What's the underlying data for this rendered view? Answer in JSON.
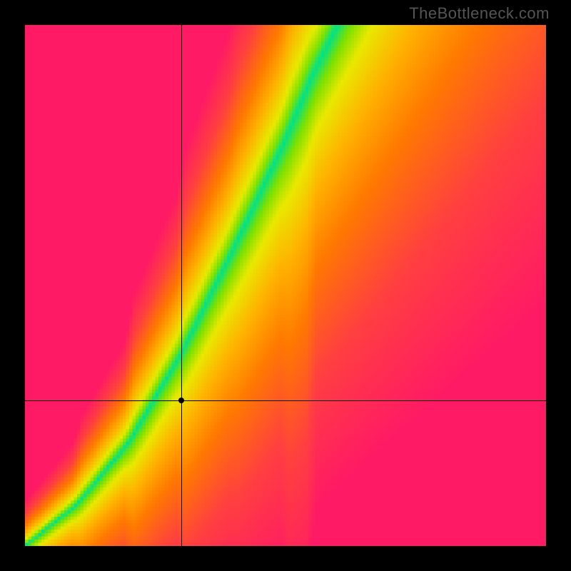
{
  "watermark": "TheBottleneck.com",
  "chart_data": {
    "type": "heatmap",
    "title": "",
    "xlabel": "",
    "ylabel": "",
    "xlim": [
      0,
      1
    ],
    "ylim": [
      0,
      1
    ],
    "grid_resolution": 160,
    "marker": {
      "x": 0.3,
      "y": 0.28
    },
    "crosshair": {
      "x": 0.3,
      "y": 0.28
    },
    "optimal_curve": {
      "description": "green ridge: ideal GPU/CPU pairing",
      "points": [
        [
          0.0,
          0.0
        ],
        [
          0.1,
          0.08
        ],
        [
          0.2,
          0.2
        ],
        [
          0.3,
          0.37
        ],
        [
          0.4,
          0.57
        ],
        [
          0.5,
          0.78
        ],
        [
          0.55,
          0.9
        ],
        [
          0.6,
          1.0
        ]
      ]
    },
    "color_stops": [
      {
        "t": 0.0,
        "hex": "#00e28a"
      },
      {
        "t": 0.06,
        "hex": "#7ee100"
      },
      {
        "t": 0.14,
        "hex": "#e9e900"
      },
      {
        "t": 0.28,
        "hex": "#ffb200"
      },
      {
        "t": 0.45,
        "hex": "#ff7a00"
      },
      {
        "t": 0.7,
        "hex": "#ff4040"
      },
      {
        "t": 1.0,
        "hex": "#ff1a66"
      }
    ]
  }
}
